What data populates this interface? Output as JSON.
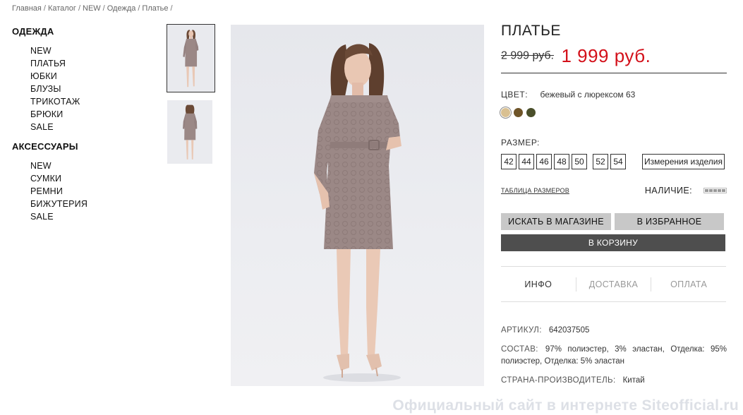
{
  "breadcrumb": [
    "Главная",
    "Каталог",
    "NEW",
    "Одежда",
    "Платье"
  ],
  "breadcrumb_separator": "/",
  "sidebar": {
    "sections": [
      {
        "title": "ОДЕЖДА",
        "items": [
          "NEW",
          "ПЛАТЬЯ",
          "ЮБКИ",
          "БЛУЗЫ",
          "ТРИКОТАЖ",
          "БРЮКИ",
          "SALE"
        ]
      },
      {
        "title": "АКСЕССУАРЫ",
        "items": [
          "NEW",
          "СУМКИ",
          "РЕМНИ",
          "БИЖУТЕРИЯ",
          "SALE"
        ]
      }
    ]
  },
  "product": {
    "title": "ПЛАТЬЕ",
    "old_price": "2 999 руб.",
    "new_price": "1 999 руб.",
    "color_label": "ЦВЕТ:",
    "color_value": "бежевый с люрексом 63",
    "swatches": [
      "#d9c091",
      "#6e5428",
      "#4a4f2a"
    ],
    "size_label": "РАЗМЕР:",
    "sizes": [
      "42",
      "44",
      "46",
      "48",
      "50",
      "52",
      "54"
    ],
    "measure_button": "Измерения изделия",
    "size_table_link": "ТАБЛИЦА РАЗМЕРОВ",
    "availability_label": "НАЛИЧИЕ:",
    "buttons": {
      "find_in_store": "ИСКАТЬ В МАГАЗИНЕ",
      "favorite": "В ИЗБРАННОЕ",
      "cart": "В КОРЗИНУ"
    },
    "tabs": [
      "ИНФО",
      "ДОСТАВКА",
      "ОПЛАТА"
    ],
    "specs": {
      "article_label": "АРТИКУЛ:",
      "article_value": "642037505",
      "composition_label": "СОСТАВ:",
      "composition_value": "97% полиэстер, 3% эластан, Отделка: 95% полиэстер, Отделка: 5% эластан",
      "country_label": "СТРАНА-ПРОИЗВОДИТЕЛЬ:",
      "country_value": "Китай"
    }
  },
  "watermark": "Официальный сайт в интернете Siteofficial.ru",
  "colors": {
    "sale_price": "#d3101a",
    "button_gray": "#c8c8c8",
    "button_dark": "#4e4e4e",
    "dress": "#9b8886"
  }
}
